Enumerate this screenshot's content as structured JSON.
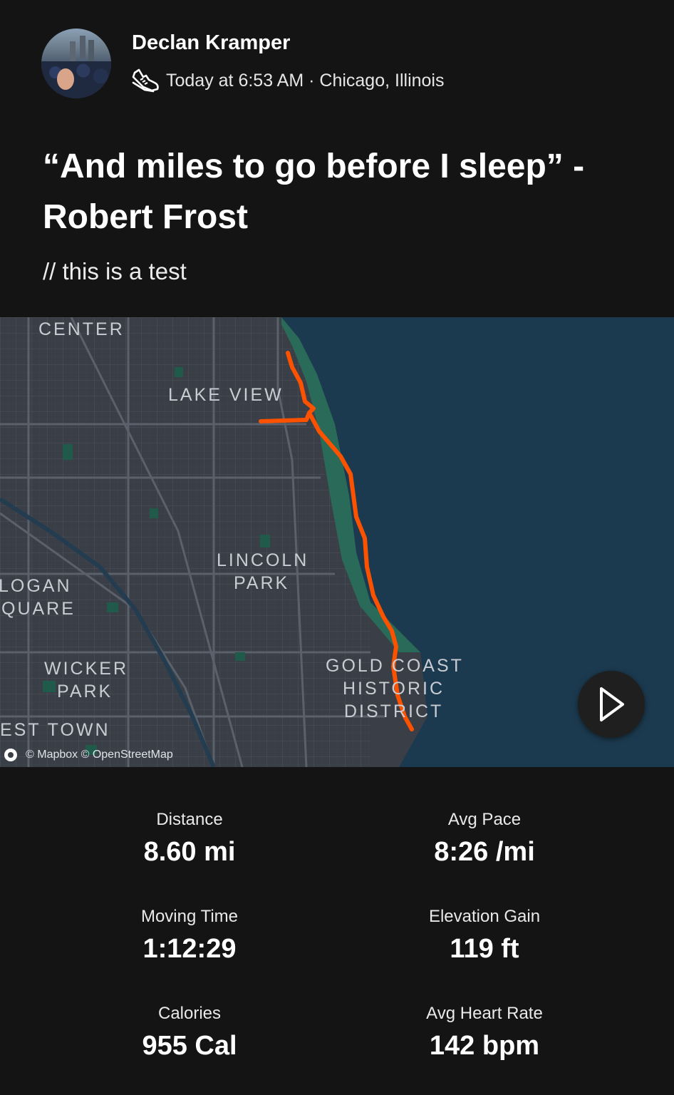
{
  "post": {
    "author": "Declan Kramper",
    "activity_icon": "running-shoe-icon",
    "meta": "Today at 6:53 AM · Chicago, Illinois",
    "title": "“And miles to go before I sleep” - Robert Frost",
    "description": "// this is a test"
  },
  "map": {
    "labels": {
      "center": "CENTER",
      "lake_view": "LAKE VIEW",
      "lincoln_park_1": "LINCOLN",
      "lincoln_park_2": "PARK",
      "logan_square_1": "LOGAN",
      "logan_square_2": "QUARE",
      "wicker_park_1": "WICKER",
      "wicker_park_2": "PARK",
      "west_town": "EST TOWN",
      "gold_coast_1": "GOLD COAST",
      "gold_coast_2": "HISTORIC",
      "gold_coast_3": "DISTRICT"
    },
    "attribution": "© Mapbox © OpenStreetMap",
    "route_color": "#fc5200",
    "water_color": "#1c3a4f",
    "land_color": "#3a3f47",
    "park_color": "#1f5a4a",
    "play_icon": "play-icon"
  },
  "stats": [
    {
      "label": "Distance",
      "value": "8.60 mi"
    },
    {
      "label": "Avg Pace",
      "value": "8:26 /mi"
    },
    {
      "label": "Moving Time",
      "value": "1:12:29"
    },
    {
      "label": "Elevation Gain",
      "value": "119 ft"
    },
    {
      "label": "Calories",
      "value": "955 Cal"
    },
    {
      "label": "Avg Heart Rate",
      "value": "142 bpm"
    }
  ]
}
